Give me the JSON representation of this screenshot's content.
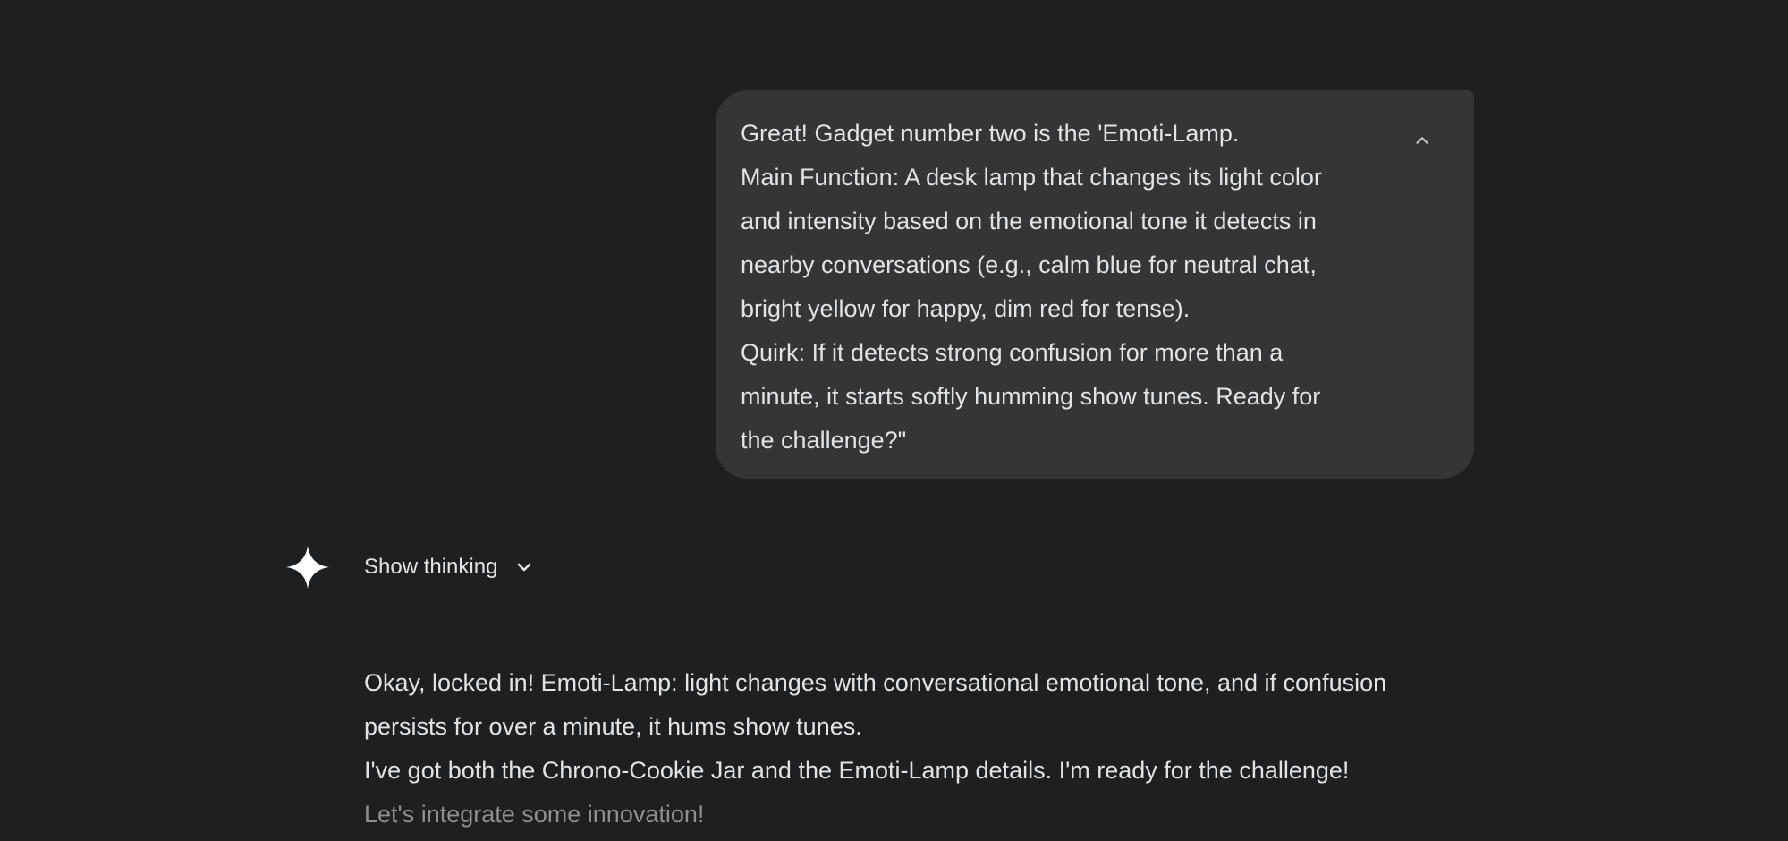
{
  "user_message": {
    "lines": [
      "Great! Gadget number two is the 'Emoti-Lamp.",
      "Main Function: A desk lamp that changes its light color",
      "and intensity based on the emotional tone it detects in",
      "nearby conversations (e.g., calm blue for neutral chat,",
      "bright yellow for happy, dim red for tense).",
      "Quirk: If it detects strong confusion for more than a",
      "minute, it starts softly humming show tunes. Ready for",
      "the challenge?\""
    ],
    "collapse_icon": "chevron-up-icon"
  },
  "assistant": {
    "icon": "gemini-sparkle-icon",
    "show_thinking_label": "Show thinking",
    "show_thinking_icon": "chevron-down-icon",
    "response": {
      "para1_lines": [
        "Okay, locked in! Emoti-Lamp: light changes with conversational emotional tone, and if confusion",
        "persists for over a minute, it hums show tunes."
      ],
      "para2_lines": [
        "I've got both the Chrono-Cookie Jar and the Emoti-Lamp details. I'm ready for the challenge!",
        "Let's integrate some innovation!"
      ]
    }
  },
  "colors": {
    "background": "#1e1f20",
    "bubble": "#333537",
    "text": "#e3e3e3",
    "faded_text": "#8e8f91"
  }
}
